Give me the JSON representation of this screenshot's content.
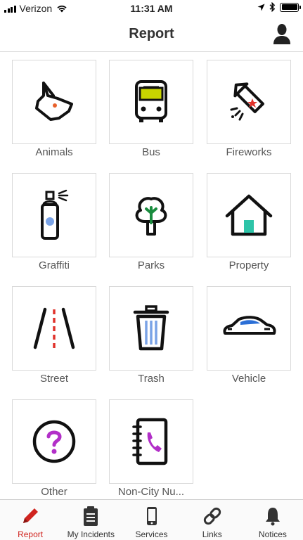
{
  "status": {
    "carrier": "Verizon",
    "time": "11:31 AM"
  },
  "header": {
    "title": "Report"
  },
  "categories": [
    {
      "label": "Animals",
      "icon": "dog-head-icon"
    },
    {
      "label": "Bus",
      "icon": "bus-icon"
    },
    {
      "label": "Fireworks",
      "icon": "firework-rocket-icon"
    },
    {
      "label": "Graffiti",
      "icon": "spray-can-icon"
    },
    {
      "label": "Parks",
      "icon": "tree-icon"
    },
    {
      "label": "Property",
      "icon": "house-icon"
    },
    {
      "label": "Street",
      "icon": "road-icon"
    },
    {
      "label": "Trash",
      "icon": "trash-can-icon"
    },
    {
      "label": "Vehicle",
      "icon": "car-icon"
    },
    {
      "label": "Other",
      "icon": "question-circle-icon"
    },
    {
      "label": "Non-City Nu...",
      "icon": "phone-book-icon"
    }
  ],
  "tabs": [
    {
      "label": "Report",
      "icon": "pencil-icon",
      "active": true
    },
    {
      "label": "My Incidents",
      "icon": "clipboard-icon",
      "active": false
    },
    {
      "label": "Services",
      "icon": "mobile-phone-icon",
      "active": false
    },
    {
      "label": "Links",
      "icon": "chain-link-icon",
      "active": false
    },
    {
      "label": "Notices",
      "icon": "bell-icon",
      "active": false
    }
  ],
  "colors": {
    "accent": "#d0241f",
    "bus_yellow": "#c8d400",
    "tree_green": "#1a8c3e",
    "house_teal": "#2ec4a8",
    "graffiti_blue": "#7aa3e6",
    "car_blue": "#2b6fd6",
    "question_purple": "#b22fc8"
  }
}
